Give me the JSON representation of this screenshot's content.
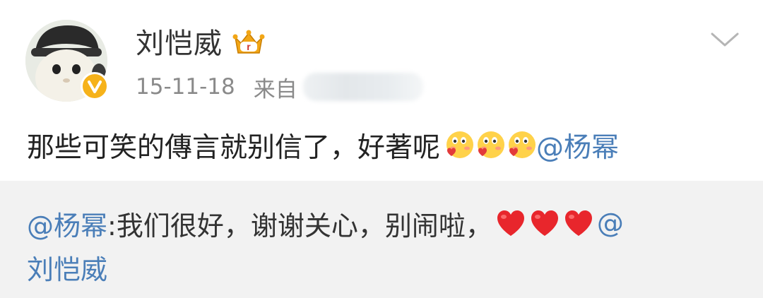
{
  "post": {
    "username": "刘恺威",
    "timestamp": "15-11-18",
    "source_prefix": "来自",
    "text": "那些可笑的傳言就别信了，好著呢",
    "emojis": [
      "blush-kiss-emoji",
      "blush-kiss-emoji",
      "blush-kiss-emoji"
    ],
    "mention": "@杨幂"
  },
  "reply": {
    "mention": "@杨幂",
    "text": " :我们很好，谢谢关心，别闹啦，",
    "hearts": [
      "heart-emoji",
      "heart-emoji",
      "heart-emoji"
    ],
    "trailing_at": "@",
    "mention_line2": "刘恺威"
  },
  "colors": {
    "link": "#4a7eb8",
    "verified": "#f6b21a",
    "reply_bg": "#f2f2f2"
  }
}
